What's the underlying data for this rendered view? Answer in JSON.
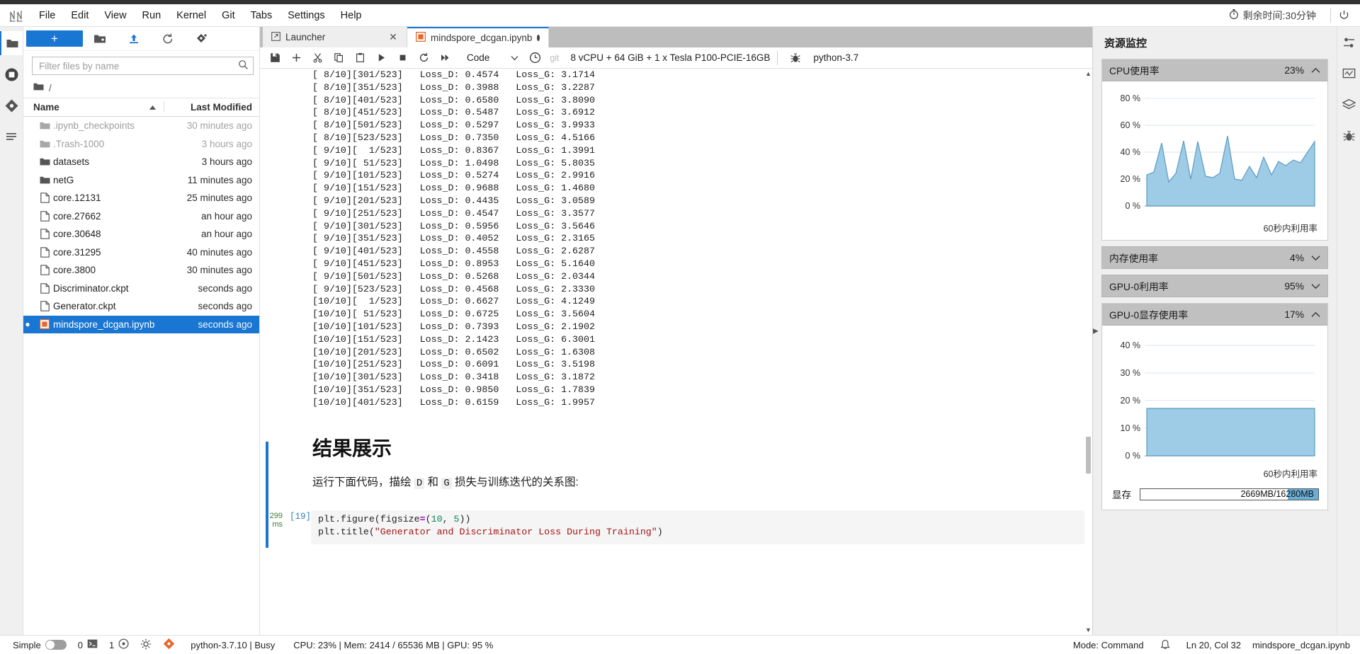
{
  "menubar": {
    "logo_name": "jupyter-logo",
    "items": [
      "File",
      "Edit",
      "View",
      "Run",
      "Kernel",
      "Git",
      "Tabs",
      "Settings",
      "Help"
    ],
    "timer_text": "剩余时间:30分钟",
    "timer_icon": "stopwatch-icon",
    "power_icon": "power-icon"
  },
  "left_activity": {
    "items": [
      {
        "name": "file-browser",
        "icon": "folder-icon",
        "active": true
      },
      {
        "name": "running-terminals",
        "icon": "stop-circle-icon",
        "active": false
      },
      {
        "name": "git-panel",
        "icon": "git-diamond-icon",
        "active": false
      },
      {
        "name": "table-of-contents",
        "icon": "list-icon",
        "active": false
      }
    ]
  },
  "filebrowser": {
    "new_button_label": "+",
    "toolbar_icons": [
      "new-folder-icon",
      "upload-icon",
      "refresh-icon",
      "git-clone-icon"
    ],
    "filter_placeholder": "Filter files by name",
    "filter_value": "",
    "search_icon": "search-icon",
    "breadcrumb_root": "/",
    "breadcrumb_icon": "folder-icon",
    "columns": {
      "name": "Name",
      "modified": "Last Modified"
    },
    "sort_icon": "sort-asc-icon",
    "rows": [
      {
        "name": ".ipynb_checkpoints",
        "modified": "30 minutes ago",
        "icon": "folder-icon",
        "kind": "folder",
        "dim": true,
        "selected": false,
        "dot": ""
      },
      {
        "name": ".Trash-1000",
        "modified": "3 hours ago",
        "icon": "folder-icon",
        "kind": "folder",
        "dim": true,
        "selected": false,
        "dot": ""
      },
      {
        "name": "datasets",
        "modified": "3 hours ago",
        "icon": "folder-icon",
        "kind": "folder",
        "dim": false,
        "selected": false,
        "dot": ""
      },
      {
        "name": "netG",
        "modified": "11 minutes ago",
        "icon": "folder-icon",
        "kind": "folder",
        "dim": false,
        "selected": false,
        "dot": ""
      },
      {
        "name": "core.12131",
        "modified": "25 minutes ago",
        "icon": "file-icon",
        "kind": "file",
        "dim": false,
        "selected": false,
        "dot": ""
      },
      {
        "name": "core.27662",
        "modified": "an hour ago",
        "icon": "file-icon",
        "kind": "file",
        "dim": false,
        "selected": false,
        "dot": ""
      },
      {
        "name": "core.30648",
        "modified": "an hour ago",
        "icon": "file-icon",
        "kind": "file",
        "dim": false,
        "selected": false,
        "dot": ""
      },
      {
        "name": "core.31295",
        "modified": "40 minutes ago",
        "icon": "file-icon",
        "kind": "file",
        "dim": false,
        "selected": false,
        "dot": ""
      },
      {
        "name": "core.3800",
        "modified": "30 minutes ago",
        "icon": "file-icon",
        "kind": "file",
        "dim": false,
        "selected": false,
        "dot": ""
      },
      {
        "name": "Discriminator.ckpt",
        "modified": "seconds ago",
        "icon": "file-icon",
        "kind": "file",
        "dim": false,
        "selected": false,
        "dot": ""
      },
      {
        "name": "Generator.ckpt",
        "modified": "seconds ago",
        "icon": "file-icon",
        "kind": "file",
        "dim": false,
        "selected": false,
        "dot": ""
      },
      {
        "name": "mindspore_dcgan.ipynb",
        "modified": "seconds ago",
        "icon": "notebook-icon",
        "kind": "notebook",
        "dim": false,
        "selected": true,
        "dot": "●"
      }
    ]
  },
  "dock": {
    "tabs": [
      {
        "label": "Launcher",
        "icon": "launcher-icon",
        "active": false,
        "close_icon": "close-icon",
        "dirty": false
      },
      {
        "label": "mindspore_dcgan.ipynb",
        "icon": "notebook-icon",
        "active": true,
        "dirty": true
      }
    ]
  },
  "notebook_toolbar": {
    "icons": [
      "save-icon",
      "add-cell-icon",
      "cut-icon",
      "copy-icon",
      "paste-icon",
      "run-icon",
      "stop-icon",
      "restart-icon",
      "restart-run-all-icon"
    ],
    "cell_type": "Code",
    "cell_type_caret": "chevron-down-icon",
    "history_icon": "clock-icon",
    "git_label": "git",
    "kernel_spec": "8 vCPU + 64 GiB + 1 x Tesla P100-PCIE-16GB",
    "debug_icon": "bug-icon",
    "kernel_name": "python-3.7"
  },
  "notebook": {
    "output_lines": [
      "[ 8/10][301/523]   Loss_D: 0.4574   Loss_G: 3.1714",
      "[ 8/10][351/523]   Loss_D: 0.3988   Loss_G: 3.2287",
      "[ 8/10][401/523]   Loss_D: 0.6580   Loss_G: 3.8090",
      "[ 8/10][451/523]   Loss_D: 0.5487   Loss_G: 3.6912",
      "[ 8/10][501/523]   Loss_D: 0.5297   Loss_G: 3.9933",
      "[ 8/10][523/523]   Loss_D: 0.7350   Loss_G: 4.5166",
      "[ 9/10][  1/523]   Loss_D: 0.8367   Loss_G: 1.3991",
      "[ 9/10][ 51/523]   Loss_D: 1.0498   Loss_G: 5.8035",
      "[ 9/10][101/523]   Loss_D: 0.5274   Loss_G: 2.9916",
      "[ 9/10][151/523]   Loss_D: 0.9688   Loss_G: 1.4680",
      "[ 9/10][201/523]   Loss_D: 0.4435   Loss_G: 3.0589",
      "[ 9/10][251/523]   Loss_D: 0.4547   Loss_G: 3.3577",
      "[ 9/10][301/523]   Loss_D: 0.5956   Loss_G: 3.5646",
      "[ 9/10][351/523]   Loss_D: 0.4052   Loss_G: 2.3165",
      "[ 9/10][401/523]   Loss_D: 0.4558   Loss_G: 2.6287",
      "[ 9/10][451/523]   Loss_D: 0.8953   Loss_G: 5.1640",
      "[ 9/10][501/523]   Loss_D: 0.5268   Loss_G: 2.0344",
      "[ 9/10][523/523]   Loss_D: 0.4568   Loss_G: 2.3330",
      "[10/10][  1/523]   Loss_D: 0.6627   Loss_G: 4.1249",
      "[10/10][ 51/523]   Loss_D: 0.6725   Loss_G: 3.5604",
      "[10/10][101/523]   Loss_D: 0.7393   Loss_G: 2.1902",
      "[10/10][151/523]   Loss_D: 2.1423   Loss_G: 6.3001",
      "[10/10][201/523]   Loss_D: 0.6502   Loss_G: 1.6308",
      "[10/10][251/523]   Loss_D: 0.6091   Loss_G: 3.5198",
      "[10/10][301/523]   Loss_D: 0.3418   Loss_G: 3.1872",
      "[10/10][351/523]   Loss_D: 0.9850   Loss_G: 1.7839",
      "[10/10][401/523]   Loss_D: 0.6159   Loss_G: 1.9957"
    ],
    "markdown_heading": "结果展示",
    "markdown_paragraph_pre": "运行下面代码，描绘 ",
    "markdown_code_1": "D",
    "markdown_paragraph_mid": " 和 ",
    "markdown_code_2": "G",
    "markdown_paragraph_post": " 损失与训练迭代的关系图:",
    "cell": {
      "timing_value": "299",
      "timing_unit": "ms",
      "prompt": "[19]",
      "line1_a": "plt.figure(figsize",
      "line1_b": "=",
      "line1_c": "(",
      "line1_num1": "10",
      "line1_sep": ", ",
      "line1_num2": "5",
      "line1_d": "))",
      "line2_a": "plt.title(",
      "line2_str": "\"Generator and Discriminator Loss During Training\"",
      "line2_b": ")"
    }
  },
  "resource_monitor": {
    "title": "资源监控",
    "panels": [
      {
        "label": "CPU使用率",
        "value": "23%",
        "expanded": true,
        "caret": "chevron-up-icon",
        "caption": "60秒内利用率",
        "chart": {
          "yticks": [
            "80 %",
            "60 %",
            "40 %",
            "20 %",
            "0 %"
          ]
        }
      },
      {
        "label": "内存使用率",
        "value": "4%",
        "expanded": false,
        "caret": "chevron-down-icon"
      },
      {
        "label": "GPU-0利用率",
        "value": "95%",
        "expanded": false,
        "caret": "chevron-down-icon"
      },
      {
        "label": "GPU-0显存使用率",
        "value": "17%",
        "expanded": true,
        "caret": "chevron-up-icon",
        "caption": "60秒内利用率",
        "chart": {
          "yticks": [
            "40 %",
            "30 %",
            "20 %",
            "10 %",
            "0 %"
          ]
        }
      }
    ],
    "mem_row": {
      "label": "显存",
      "text": "2669MB/16280MB",
      "fill_percent": 17
    }
  },
  "right_activity": {
    "items": [
      {
        "name": "property-inspector",
        "icon": "sliders-icon"
      },
      {
        "name": "resource-monitor",
        "icon": "monitor-icon"
      },
      {
        "name": "extension-manager",
        "icon": "layers-icon"
      },
      {
        "name": "debugger",
        "icon": "bug-icon"
      }
    ]
  },
  "statusbar": {
    "simple_label": "Simple",
    "toggle_on": false,
    "terminals_count": "0",
    "terminal_icon": "terminal-icon",
    "kernels_count": "1",
    "kernel_icon": "kernel-icon",
    "settings_icon": "gear-icon",
    "git_icon": "git-icon",
    "kernel_status": "python-3.7.10 | Busy",
    "resources": "CPU: 23% | Mem: 2414 / 65536 MB | GPU: 95 %",
    "command_mode": "Mode: Command",
    "notification_icon": "bell-icon",
    "cursor_position": "Ln 20, Col 32",
    "filename": "mindspore_dcgan.ipynb"
  },
  "chart_data": [
    {
      "type": "area",
      "title": "CPU使用率",
      "xlabel": "60秒内利用率",
      "ylabel": "",
      "ylim": [
        0,
        90
      ],
      "yticks": [
        0,
        20,
        40,
        60,
        80
      ],
      "x": [
        0,
        1,
        2,
        3,
        4,
        5,
        6,
        7,
        8,
        9,
        10,
        11,
        12,
        13,
        14,
        15,
        16,
        17,
        18,
        19,
        20,
        21,
        22,
        23
      ],
      "values": [
        23,
        25,
        47,
        18,
        24,
        49,
        20,
        48,
        22,
        21,
        24,
        52,
        20,
        19,
        28,
        21,
        36,
        23,
        33,
        30,
        34,
        32,
        40,
        49
      ],
      "grid": true,
      "legend": "none",
      "color": "#8ec4e0"
    },
    {
      "type": "area",
      "title": "GPU-0显存使用率",
      "xlabel": "60秒内利用率",
      "ylabel": "",
      "ylim": [
        0,
        45
      ],
      "yticks": [
        0,
        10,
        20,
        30,
        40
      ],
      "x": [
        0,
        1,
        2,
        3,
        4,
        5,
        6,
        7,
        8,
        9,
        10,
        11,
        12,
        13,
        14,
        15,
        16,
        17,
        18,
        19,
        20,
        21,
        22,
        23
      ],
      "values": [
        17,
        17,
        17,
        17,
        17,
        17,
        17,
        17,
        17,
        17,
        17,
        17,
        17,
        17,
        17,
        17,
        17,
        17,
        17,
        17,
        17,
        17,
        17,
        17
      ],
      "grid": true,
      "legend": "none",
      "color": "#8ec4e0"
    }
  ]
}
